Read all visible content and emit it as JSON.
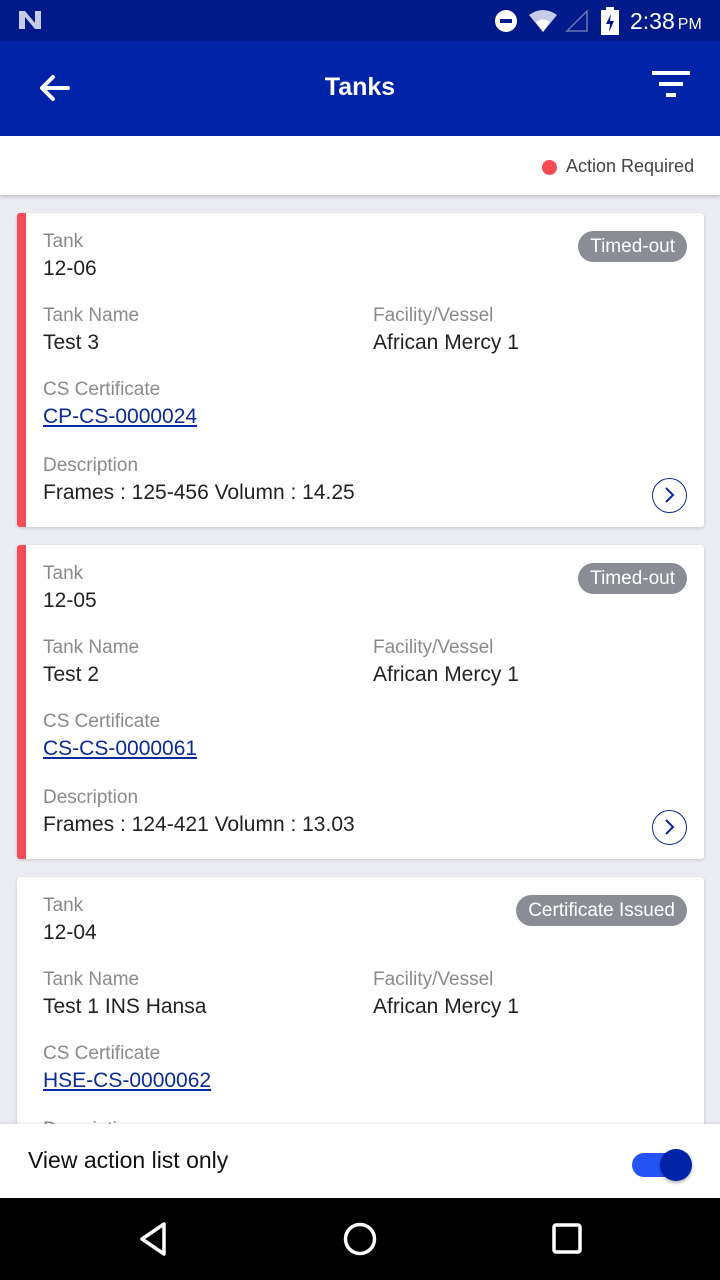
{
  "status_bar": {
    "time": "2:38",
    "ampm": "PM",
    "icons": [
      "n-logo-icon",
      "dnd-icon",
      "wifi-icon",
      "signal-icon",
      "battery-charging-icon"
    ]
  },
  "app_bar": {
    "title": "Tanks",
    "back_icon": "arrow-left-icon",
    "filter_icon": "filter-icon"
  },
  "legend": {
    "label": "Action Required",
    "color": "#f44b55"
  },
  "labels": {
    "tank": "Tank",
    "tank_name": "Tank Name",
    "facility": "Facility/Vessel",
    "cs_certificate": "CS Certificate",
    "description": "Description"
  },
  "cards": [
    {
      "tank": "12-06",
      "status": "Timed-out",
      "tank_name": "Test 3",
      "facility": "African Mercy 1",
      "certificate": "CP-CS-0000024",
      "description": "Frames : 125-456 Volumn : 14.25",
      "action_required": true
    },
    {
      "tank": "12-05",
      "status": "Timed-out",
      "tank_name": "Test 2",
      "facility": "African Mercy 1",
      "certificate": "CS-CS-0000061",
      "description": "Frames : 124-421 Volumn : 13.03",
      "action_required": true
    },
    {
      "tank": "12-04",
      "status": "Certificate Issued",
      "tank_name": "Test 1 INS Hansa",
      "facility": "African Mercy 1",
      "certificate": "HSE-CS-0000062",
      "action_required": false
    }
  ],
  "bottom": {
    "toggle_label": "View action list only",
    "toggle_on": true,
    "accent": "#2452f5"
  },
  "colors": {
    "primary": "#0023a8",
    "status_bar": "#001a8a",
    "action": "#f44b55"
  }
}
